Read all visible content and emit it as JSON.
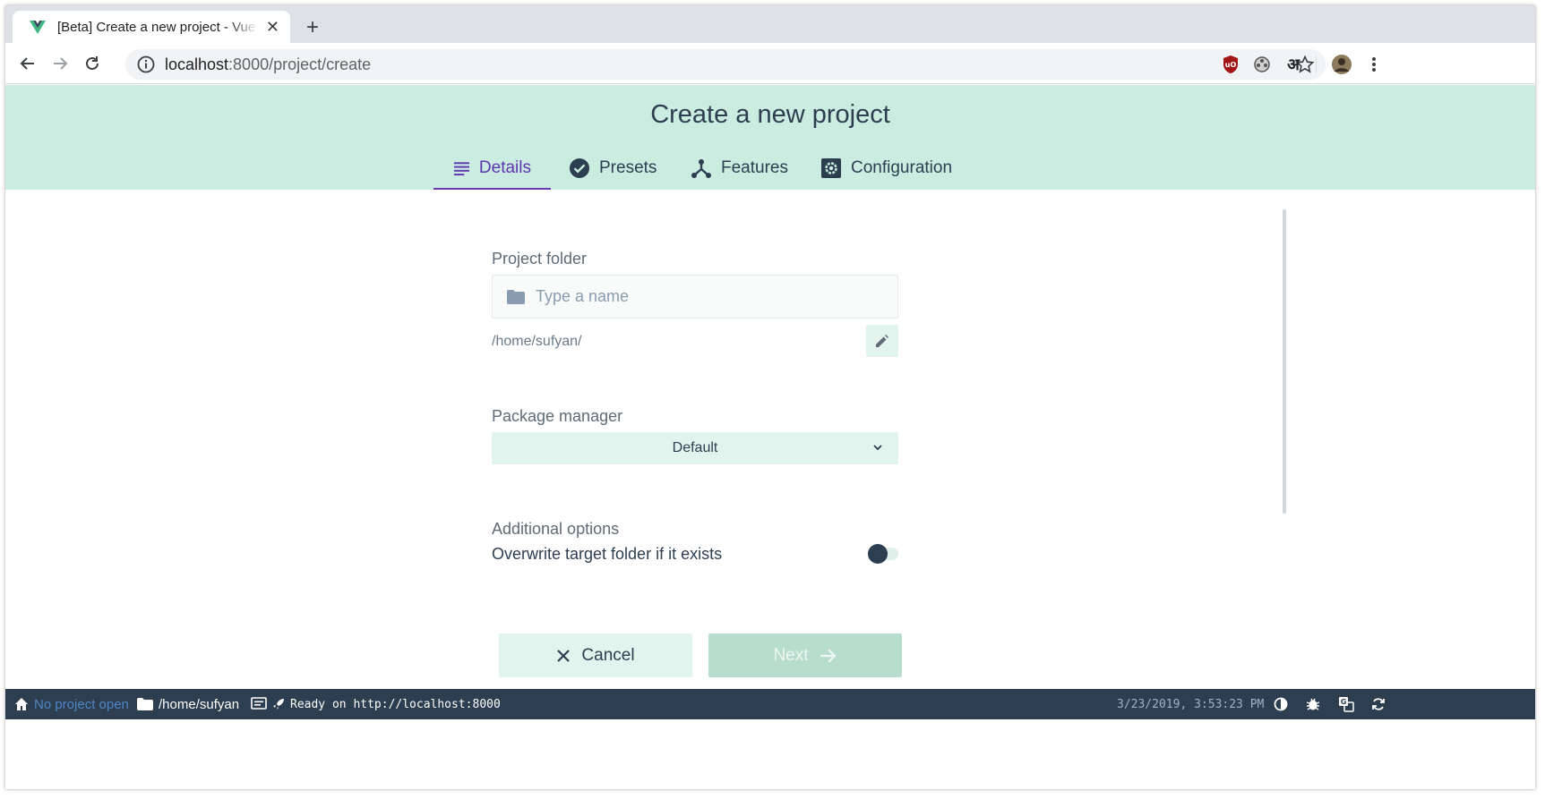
{
  "browser": {
    "tab_title": "[Beta] Create a new project - Vue CLI",
    "new_tab_symbol": "+",
    "url_host": "localhost",
    "url_path": ":8000/project/create",
    "extension_devanagari": "अ"
  },
  "header": {
    "title": "Create a new project",
    "tabs": [
      {
        "label": "Details",
        "icon": "list-icon",
        "active": true
      },
      {
        "label": "Presets",
        "icon": "check-circle-icon",
        "active": false
      },
      {
        "label": "Features",
        "icon": "merge-icon",
        "active": false
      },
      {
        "label": "Configuration",
        "icon": "settings-box-icon",
        "active": false
      }
    ]
  },
  "form": {
    "project_folder": {
      "label": "Project folder",
      "value": "",
      "placeholder": "Type a name",
      "path": "/home/sufyan/"
    },
    "package_manager": {
      "label": "Package manager",
      "selected": "Default"
    },
    "additional_options": {
      "label": "Additional options",
      "overwrite_label": "Overwrite target folder if it exists",
      "overwrite_enabled": false
    }
  },
  "actions": {
    "cancel_label": "Cancel",
    "next_label": "Next"
  },
  "statusbar": {
    "project": "No project open",
    "cwd": "/home/sufyan",
    "log": "Ready on http://localhost:8000",
    "datetime": "3/23/2019, 3:53:23 PM"
  },
  "colors": {
    "header_bg": "#cbece0",
    "accent": "#6a3ab2",
    "statusbar_bg": "#2c3e50",
    "button_bg": "#e3f3ed"
  }
}
